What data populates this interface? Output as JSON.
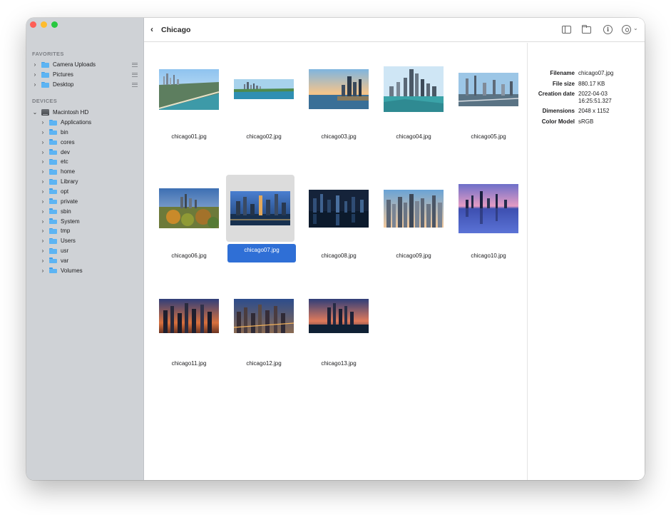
{
  "window": {
    "title": "Chicago"
  },
  "sidebar": {
    "favorites_title": "FAVORITES",
    "favorites": [
      "Camera Uploads",
      "Pictures",
      "Desktop"
    ],
    "devices_title": "DEVICES",
    "device_name": "Macintosh HD",
    "device_children": [
      "Applications",
      "bin",
      "cores",
      "dev",
      "etc",
      "home",
      "Library",
      "opt",
      "private",
      "sbin",
      "System",
      "tmp",
      "Users",
      "usr",
      "var",
      "Volumes"
    ]
  },
  "files": [
    {
      "name": "chicago01.jpg"
    },
    {
      "name": "chicago02.jpg"
    },
    {
      "name": "chicago03.jpg"
    },
    {
      "name": "chicago04.jpg"
    },
    {
      "name": "chicago05.jpg"
    },
    {
      "name": "chicago06.jpg"
    },
    {
      "name": "chicago07.jpg",
      "selected": true
    },
    {
      "name": "chicago08.jpg"
    },
    {
      "name": "chicago09.jpg"
    },
    {
      "name": "chicago10.jpg"
    },
    {
      "name": "chicago11.jpg"
    },
    {
      "name": "chicago12.jpg"
    },
    {
      "name": "chicago13.jpg"
    }
  ],
  "info": {
    "filename_label": "Filename",
    "filename": "chicago07.jpg",
    "filesize_label": "File size",
    "filesize": "880.17 KB",
    "created_label": "Creation date",
    "created": "2022-04-03 16:25:51.327",
    "dimensions_label": "Dimensions",
    "dimensions": "2048 x 1152",
    "colormodel_label": "Color Model",
    "colormodel": "sRGB"
  },
  "colors": {
    "sidebar_bg": "#cfd2d6",
    "selection": "#2f6fd6",
    "folder": "#5db4f3"
  }
}
